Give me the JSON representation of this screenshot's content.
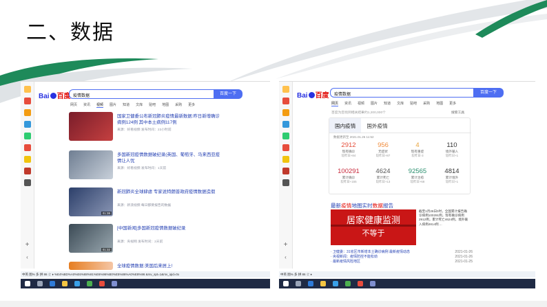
{
  "slide": {
    "title": "二、数据",
    "colors": {
      "accent_green": "#1e8a5a",
      "accent_gray": "#c9ced3",
      "baidu_blue": "#4e6ef2",
      "baidu_red": "#e10601"
    }
  },
  "left_browser": {
    "logo_bai": "Bai",
    "logo_du": "百度",
    "search_value": "疫情数据",
    "search_button": "百度一下",
    "tabs": [
      "网页",
      "资讯",
      "视频",
      "图片",
      "知道",
      "文库",
      "贴吧",
      "地图",
      "采购",
      "更多"
    ],
    "results": [
      {
        "title": "国家卫健委公布新冠肺炎疫情最新数据:昨日新增确诊病例124例 其中本土病例117例",
        "meta": "来源：好看视频  发布时间：23小时前",
        "duration": ""
      },
      {
        "title": "多国新冠疫情数据破纪录(英国、葡萄牙、马来西亚疫情让人忧",
        "meta": "来源：好看视频  发布时间：1天前",
        "duration": ""
      },
      {
        "title": "新冠肺炎全球肆虐 专家说特朗普政府疫情数据造假",
        "meta": "来源：新浪视频  每日都要报告的数据",
        "duration": "01:38"
      },
      {
        "title": "[中国新闻]多国新冠疫情数据破纪录",
        "meta": "来源：央视网  发布时间：2天前",
        "duration": "01:32"
      },
      {
        "title": "全球疫情数据:美国后来居上!",
        "meta": "",
        "duration": ""
      }
    ],
    "address": "中英 图% 多 拼 86  ☆  ♦  %E4%BD%A0%E6%88%91%E6%96%B0%E5%86%A0%E8%96 &rsv_spt=1&rsv_iqid=0x"
  },
  "right_browser": {
    "logo_bai": "Bai",
    "logo_du": "百度",
    "search_value": "疫情数据",
    "search_button": "百度一下",
    "tabs": [
      "网页",
      "资讯",
      "视频",
      "图片",
      "知道",
      "文库",
      "贴吧",
      "采购",
      "地图",
      "更多"
    ],
    "result_count": "百度为您找到相关结果约1,200,000个",
    "tools": "搜索工具",
    "card": {
      "tabs": [
        "国内疫情",
        "国外疫情"
      ],
      "date": "数据更新至 2021.01.26 11:52",
      "stats": [
        {
          "value": "2912",
          "label": "现有确诊",
          "delta": "较昨日+84",
          "color": "#e44d3a"
        },
        {
          "value": "956",
          "label": "无症状",
          "delta": "较昨日+87",
          "color": "#f08c3c"
        },
        {
          "value": "4",
          "label": "现有重症",
          "delta": "较昨日-3",
          "color": "#e8a33b"
        },
        {
          "value": "110",
          "label": "境外输入",
          "delta": "较昨日+1",
          "color": "#333333"
        },
        {
          "value": "100291",
          "label": "累计确诊",
          "delta": "较昨日+155",
          "color": "#c7293b"
        },
        {
          "value": "4624",
          "label": "累计死亡",
          "delta": "较昨日+13",
          "color": "#555555"
        },
        {
          "value": "92565",
          "label": "累计治愈",
          "delta": "较昨日+68",
          "color": "#2a8f6e"
        },
        {
          "value": "4814",
          "label": "累计境外",
          "delta": "较昨日+1",
          "color": "#333333"
        }
      ]
    },
    "map_title_a": "最新",
    "map_title_hl": "疫情",
    "map_title_b": "地图实时",
    "map_title_hl2": "数据",
    "map_title_c": "报告",
    "banner_line1": "居家健康监测",
    "banner_line2": "不等于",
    "side_text": "截至1月26日0时，全国累计报告确诊病例100291例，现有确诊病例2912例，累计死亡4624例，境外输入病例4814例 ...",
    "news": [
      {
        "title": "· 卫健委：31省区市新增本土确诊病例 最新疫情动态",
        "date": "2021-01-26"
      },
      {
        "title": "· 央视新闻：疫情防控不能松劲",
        "date": "2021-01-26"
      },
      {
        "title": "· 最新疫情风险地区",
        "date": "2021-01-25"
      }
    ],
    "address": "中英 图% 多 拼 86  ☆  ♦"
  }
}
